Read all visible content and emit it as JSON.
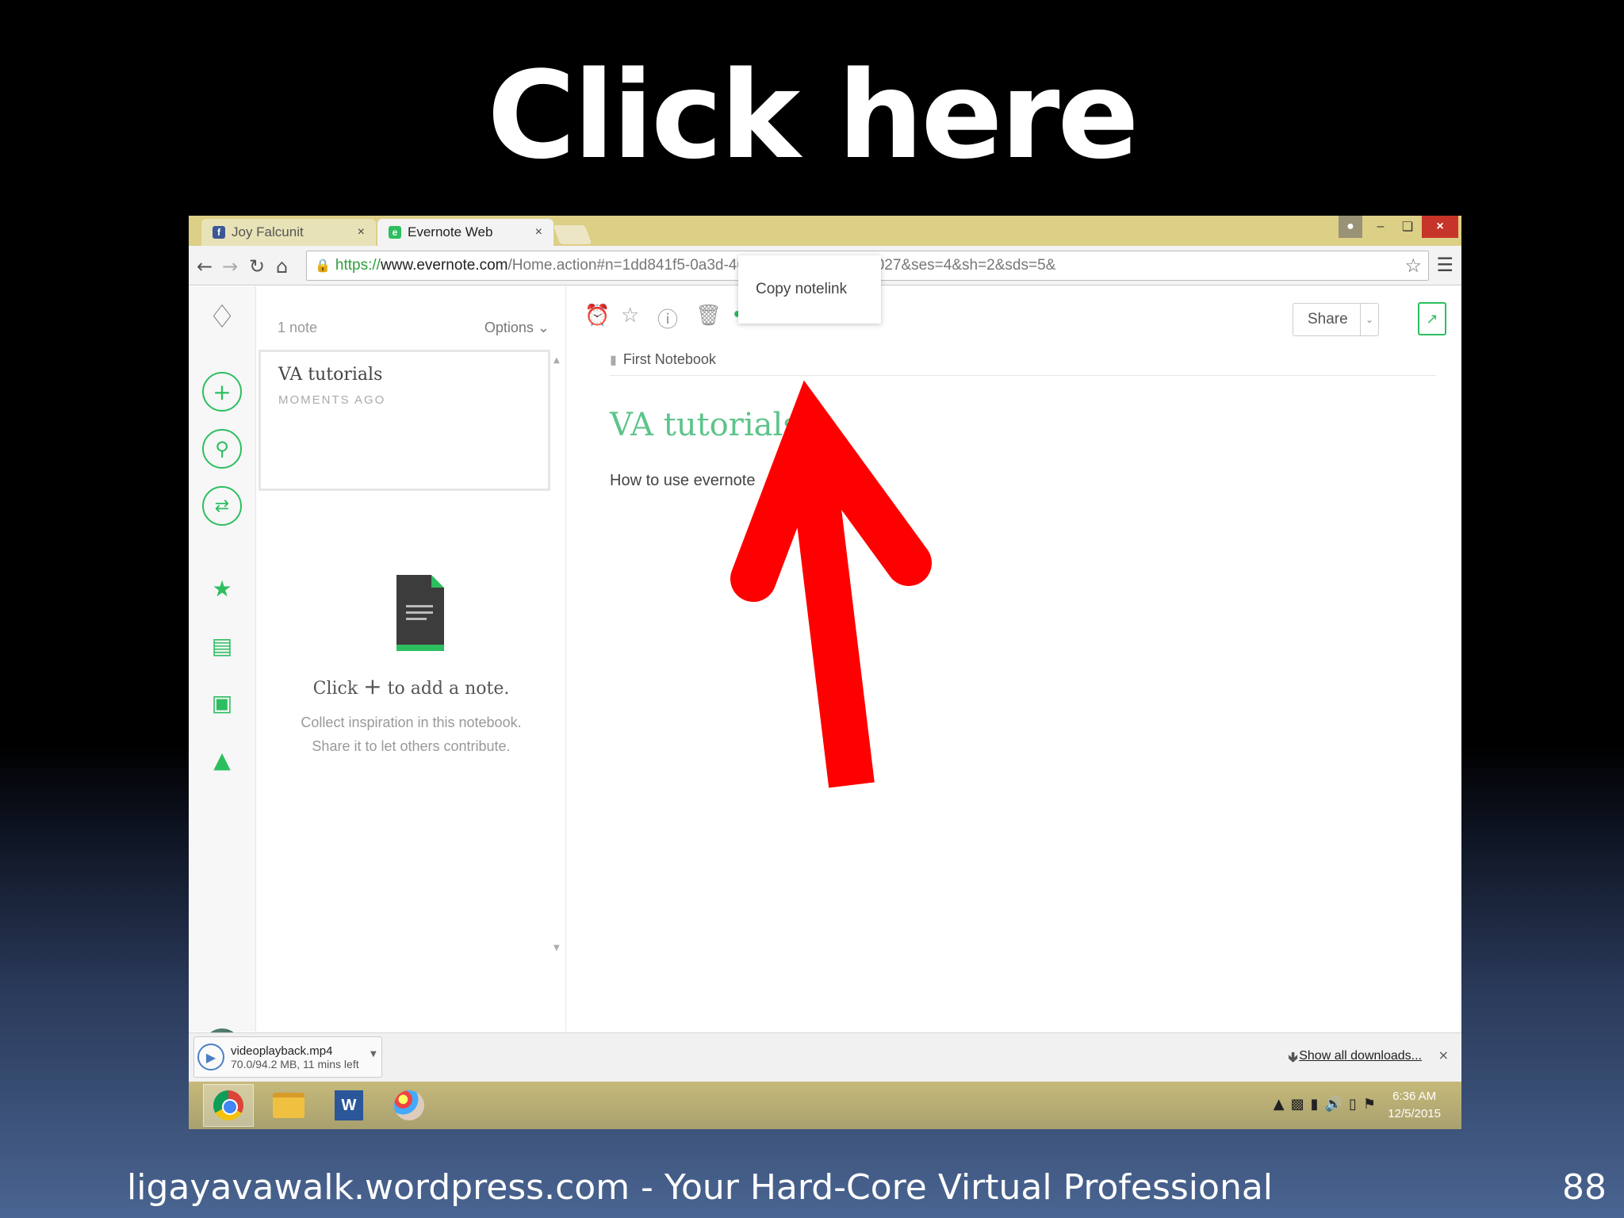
{
  "slide": {
    "title": "Click here",
    "footer": "ligayavawalk.wordpress.com - Your Hard-Core Virtual Professional",
    "page_number": "88"
  },
  "browser": {
    "tabs": [
      {
        "label": "Joy Falcunit",
        "icon": "facebook-icon"
      },
      {
        "label": "Evernote Web",
        "icon": "evernote-icon"
      }
    ],
    "url": {
      "scheme": "https://",
      "host": "www.evernote.com",
      "path": "/Home.action#n=1dd841f5-0a3d-4608-8c27-f0e996257027&ses=4&sh=2&sds=5&"
    }
  },
  "note_list": {
    "count_label": "1 note",
    "options_label": "Options",
    "note": {
      "title": "VA tutorials",
      "time": "MOMENTS AGO"
    },
    "empty": {
      "title_prefix": "Click",
      "title_suffix": "to add a note.",
      "line1": "Collect inspiration in this notebook.",
      "line2": "Share it to let others contribute."
    }
  },
  "editor": {
    "notebook": "First Notebook",
    "dropdown_item": "Copy notelink",
    "note_title": "VA tutorials",
    "note_body": "How to use evernote",
    "share_label": "Share"
  },
  "downloads": {
    "file_name": "videoplayback.mp4",
    "status": "70.0/94.2 MB, 11 mins left",
    "show_all": "Show all downloads..."
  },
  "taskbar": {
    "time": "6:36 AM",
    "date": "12/5/2015"
  },
  "colors": {
    "evernote_green": "#2dbe60",
    "arrow_red": "#ff0000"
  }
}
